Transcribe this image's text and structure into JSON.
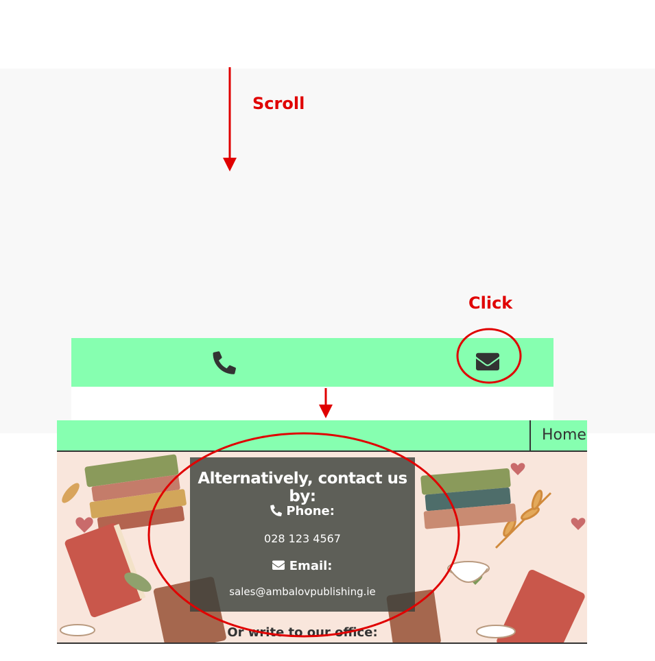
{
  "annotations": {
    "scroll_label": "Scroll",
    "click_label": "Click"
  },
  "footer": {
    "phone_icon": "phone-icon",
    "email_icon": "envelope-icon"
  },
  "nav": {
    "home_label": "Home"
  },
  "contact_panel": {
    "title": "Alternatively, contact us by:",
    "phone_label": "Phone:",
    "phone_value": "028 123 4567",
    "email_label": "Email:",
    "email_value": "sales@ambalovpublishing.ie"
  },
  "office": {
    "write_label": "Or write to our office:"
  },
  "colors": {
    "accent_green": "#86ffb0",
    "annotation_red": "#e00000",
    "panel_bg": "#3c413a",
    "hero_bg": "#f9e6dc"
  }
}
